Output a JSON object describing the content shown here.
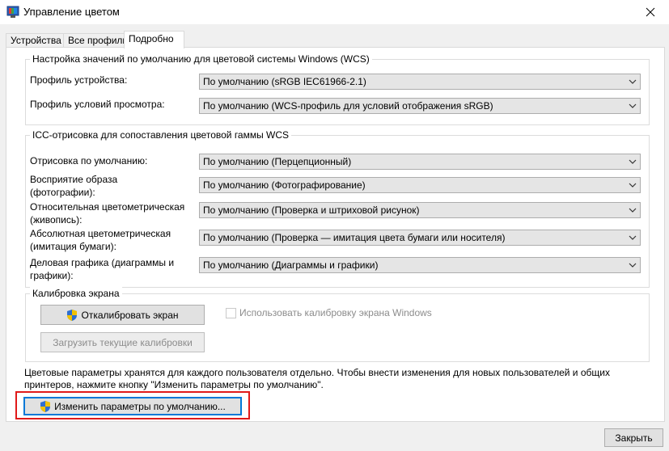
{
  "window": {
    "title": "Управление цветом",
    "icon": "color-monitor-icon",
    "close_icon": "close-icon"
  },
  "tabs": [
    {
      "label": "Устройства",
      "active": false
    },
    {
      "label": "Все профили",
      "active": false
    },
    {
      "label": "Подробно",
      "active": true
    }
  ],
  "wcs_defaults": {
    "title": "Настройка значений по умолчанию для цветовой системы Windows (WCS)",
    "rows": [
      {
        "label": "Профиль устройства:",
        "value": "По умолчанию (sRGB IEC61966-2.1)"
      },
      {
        "label": "Профиль условий просмотра:",
        "value": "По умолчанию (WCS-профиль для условий отображения sRGB)"
      }
    ]
  },
  "icc_rendering": {
    "title": "ICC-отрисовка для сопоставления цветовой гаммы WCS",
    "rows": [
      {
        "label": "Отрисовка по умолчанию:",
        "value": "По умолчанию (Перцепционный)"
      },
      {
        "label": "Восприятие образа\n(фотографии):",
        "value": "По умолчанию (Фотографирование)"
      },
      {
        "label": "Относительная цветометрическая\n(живопись):",
        "value": "По умолчанию (Проверка и штриховой рисунок)"
      },
      {
        "label": "Абсолютная цветометрическая\n(имитация бумаги):",
        "value": "По умолчанию (Проверка — имитация цвета бумаги или носителя)"
      },
      {
        "label": "Деловая графика (диаграммы и\nграфики):",
        "value": "По умолчанию (Диаграммы и графики)"
      }
    ]
  },
  "calibration": {
    "title": "Калибровка экрана",
    "calibrate_button": "Откалибровать экран",
    "load_button": "Загрузить текущие калибровки",
    "use_windows_calibration": "Использовать калибровку экрана Windows",
    "use_windows_calibration_checked": false
  },
  "info_text": "Цветовые параметры хранятся для каждого пользователя отдельно. Чтобы внести изменения для новых пользователей и общих принтеров, нажмите кнопку \"Изменить параметры по умолчанию\".",
  "change_defaults_button": "Изменить параметры по умолчанию...",
  "close_button": "Закрыть",
  "colors": {
    "accent": "#0078d7",
    "highlight": "#e01a1a"
  }
}
